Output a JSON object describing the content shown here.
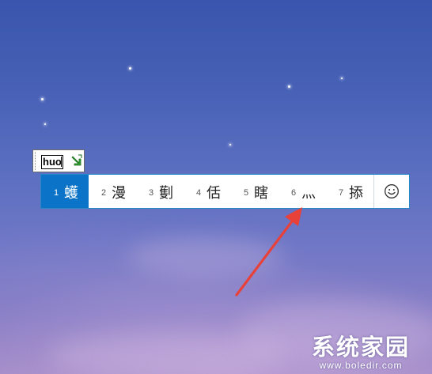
{
  "ime": {
    "composition_text": "huo",
    "mode_icon": "green-arrow-icon",
    "selected_index": 0,
    "candidates": [
      {
        "num": "1",
        "char": "蠖"
      },
      {
        "num": "2",
        "char": "漫"
      },
      {
        "num": "3",
        "char": "劐"
      },
      {
        "num": "4",
        "char": "佸"
      },
      {
        "num": "5",
        "char": "瞎"
      },
      {
        "num": "6",
        "char": "灬"
      },
      {
        "num": "7",
        "char": "掭"
      }
    ],
    "emoji_icon": "smiley-icon"
  },
  "annotation": {
    "arrow_color": "#e8413a",
    "target": "candidate 6"
  },
  "watermark": {
    "title": "系统家园",
    "url": "www.boledir.com"
  },
  "colors": {
    "selection": "#0b74c8",
    "border": "#2a88c6"
  }
}
